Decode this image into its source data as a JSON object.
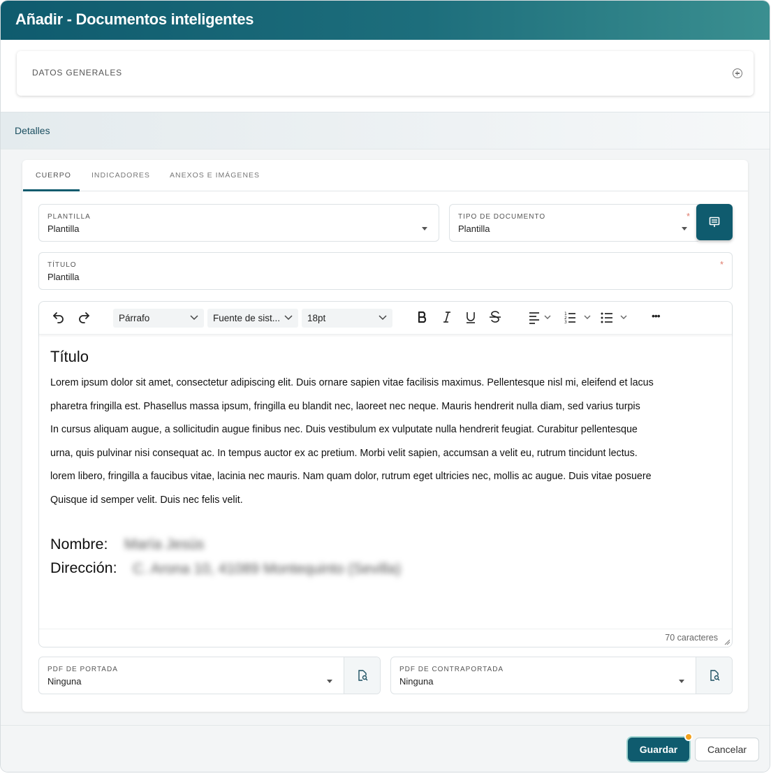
{
  "header": {
    "title": "Añadir - Documentos inteligentes"
  },
  "general": {
    "label": "DATOS GENERALES",
    "toggle_icon": "circle-plus-icon"
  },
  "details": {
    "label": "Detalles"
  },
  "tabs": [
    {
      "label": "CUERPO",
      "active": true
    },
    {
      "label": "INDICADORES",
      "active": false
    },
    {
      "label": "ANEXOS E IMÁGENES",
      "active": false
    }
  ],
  "form": {
    "plantilla": {
      "label": "PLANTILLA",
      "value": "Plantilla"
    },
    "tipo_documento": {
      "label": "TIPO DE DOCUMENTO",
      "value": "Plantilla",
      "required_mark": "*"
    },
    "titulo": {
      "label": "TÍTULO",
      "value": "Plantilla",
      "required_mark": "*"
    },
    "pdf_portada": {
      "label": "PDF DE PORTADA",
      "value": "Ninguna"
    },
    "pdf_contraportada": {
      "label": "PDF DE CONTRAPORTADA",
      "value": "Ninguna"
    }
  },
  "toolbar": {
    "block_format": "Párrafo",
    "font_family": "Fuente de sist...",
    "font_size": "18pt",
    "more": "•••"
  },
  "document": {
    "title": "Título",
    "lines": [
      "Lorem ipsum dolor sit amet, consectetur adipiscing elit. Duis ornare sapien vitae facilisis maximus. Pellentesque nisl mi, eleifend et lacus",
      "pharetra fringilla est. Phasellus massa ipsum, fringilla eu blandit nec, laoreet nec neque. Mauris hendrerit nulla diam, sed varius turpis",
      "In cursus aliquam augue, a sollicitudin augue finibus nec. Duis vestibulum ex vulputate nulla hendrerit feugiat. Curabitur pellentesque",
      "urna, quis pulvinar nisi consequat ac. In tempus auctor ex ac pretium. Morbi velit sapien, accumsan a velit eu, rutrum tincidunt lectus.",
      "lorem libero, fringilla a faucibus vitae, lacinia nec mauris. Nam quam dolor, rutrum eget ultricies nec, mollis ac augue. Duis vitae posuere",
      "Quisque id semper velit. Duis nec felis velit."
    ],
    "nombre_label": "Nombre:",
    "nombre_value": "María Jesús",
    "direccion_label": "Dirección:",
    "direccion_value": "C. Arona 10, 41089 Montequinto (Sevilla)"
  },
  "editor": {
    "char_count": "70 caracteres"
  },
  "actions": {
    "save": "Guardar",
    "cancel": "Cancelar"
  },
  "colors": {
    "primary": "#0f5b6e",
    "required": "#e07a6b",
    "badge": "#f3a11e"
  }
}
